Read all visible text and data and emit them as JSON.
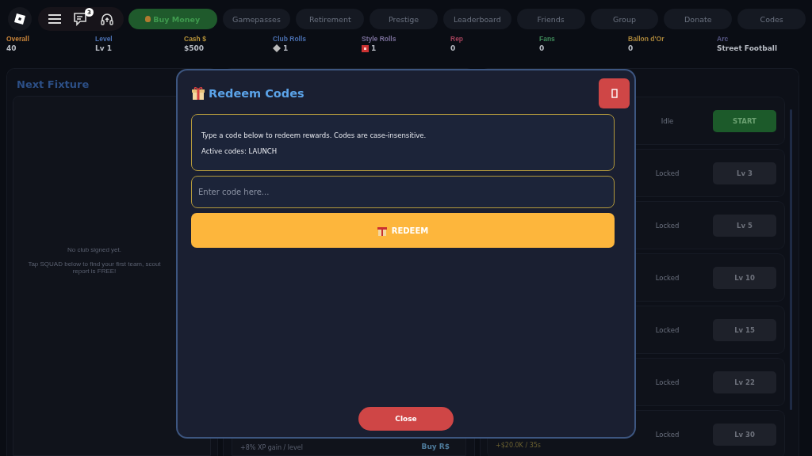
{
  "topbar": {
    "notification_count": "3",
    "tabs": [
      {
        "label": "Buy Money",
        "kind": "shop",
        "selected": false
      },
      {
        "label": "Gamepasses",
        "kind": "plain",
        "selected": false
      },
      {
        "label": "Retirement",
        "kind": "plain",
        "selected": false
      },
      {
        "label": "Prestige",
        "kind": "plain",
        "selected": false
      },
      {
        "label": "Leaderboard",
        "kind": "plain",
        "selected": false
      },
      {
        "label": "Friends",
        "kind": "plain",
        "selected": false
      },
      {
        "label": "Group",
        "kind": "plain",
        "selected": false
      },
      {
        "label": "Donate",
        "kind": "plain",
        "selected": false
      },
      {
        "label": "Codes",
        "kind": "plain",
        "selected": false
      }
    ]
  },
  "stats": [
    {
      "label": "Overall",
      "value": "40",
      "color": "#c8843a"
    },
    {
      "label": "Level",
      "value": "Lv 1",
      "color": "#4a6fb0"
    },
    {
      "label": "Cash $",
      "value": "$500",
      "color": "#b8943a"
    },
    {
      "label": "Club Rolls",
      "value": "1",
      "color": "#4a6fb0",
      "kind": "ticket"
    },
    {
      "label": "Style Rolls",
      "value": "1",
      "color": "#7a6f9a",
      "kind": "card"
    },
    {
      "label": "Rep",
      "value": "0",
      "color": "#a0405a"
    },
    {
      "label": "Fans",
      "value": "0",
      "color": "#3f8a5a"
    },
    {
      "label": "Ballon d'Or",
      "value": "0",
      "color": "#a8843a"
    },
    {
      "label": "Arc",
      "value": "Street Football",
      "color": "#5a5a8a"
    }
  ],
  "fixture_panel": {
    "title": "Next Fixture",
    "message": "No club signed yet.",
    "hint": "Tap SQUAD below to find your first team, scout report is FREE!"
  },
  "middle_panel": {
    "perk": "+8% XP gain / level",
    "action": "Buy R$"
  },
  "jobs": [
    {
      "status": "Idle",
      "button": "START",
      "kind": "start"
    },
    {
      "status": "Locked",
      "button": "Lv 3",
      "kind": "locked"
    },
    {
      "status": "Locked",
      "button": "Lv 5",
      "kind": "locked"
    },
    {
      "status": "Locked",
      "button": "Lv 10",
      "kind": "locked"
    },
    {
      "status": "Locked",
      "button": "Lv 15",
      "kind": "locked"
    },
    {
      "status": "Locked",
      "button": "Lv 22",
      "kind": "locked"
    },
    {
      "status": "Locked",
      "button": "Lv 30",
      "kind": "locked",
      "income": "+$20.0K / 35s"
    }
  ],
  "dialog": {
    "title": "Redeem Codes",
    "info": [
      "Type a code below to redeem rewards. Codes are case-insensitive.",
      "Active codes: LAUNCH"
    ],
    "placeholder": "Enter code here...",
    "redeem": "REDEEM",
    "close": "Close"
  }
}
